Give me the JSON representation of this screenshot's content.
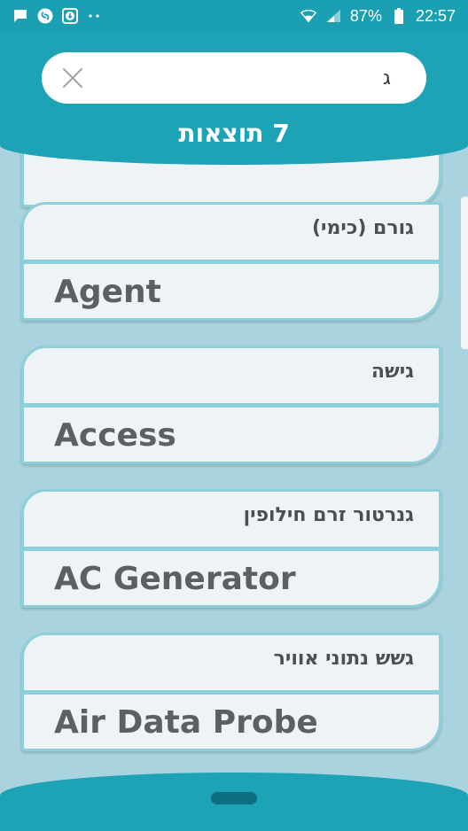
{
  "status_bar": {
    "battery": "87%",
    "time": "22:57",
    "icons": [
      "message-icon",
      "shazam-icon",
      "download-icon",
      "dots-icon",
      "wifi-icon",
      "signal-icon",
      "battery-icon"
    ]
  },
  "search": {
    "value": "ג"
  },
  "results_count": "7 תוצאות",
  "results": [
    {
      "hebrew": "גורם (כימי)",
      "english": "Agent"
    },
    {
      "hebrew": "גישה",
      "english": "Access"
    },
    {
      "hebrew": "גנרטור זרם חילופין",
      "english": "AC Generator"
    },
    {
      "hebrew": "גשש נתוני אוויר",
      "english": "Air Data Probe"
    }
  ],
  "colors": {
    "primary": "#1ea2b6",
    "background": "#a9d3de",
    "card": "#eef4f5",
    "card_border": "#8ecfdc",
    "handle": "#0d6f80"
  }
}
